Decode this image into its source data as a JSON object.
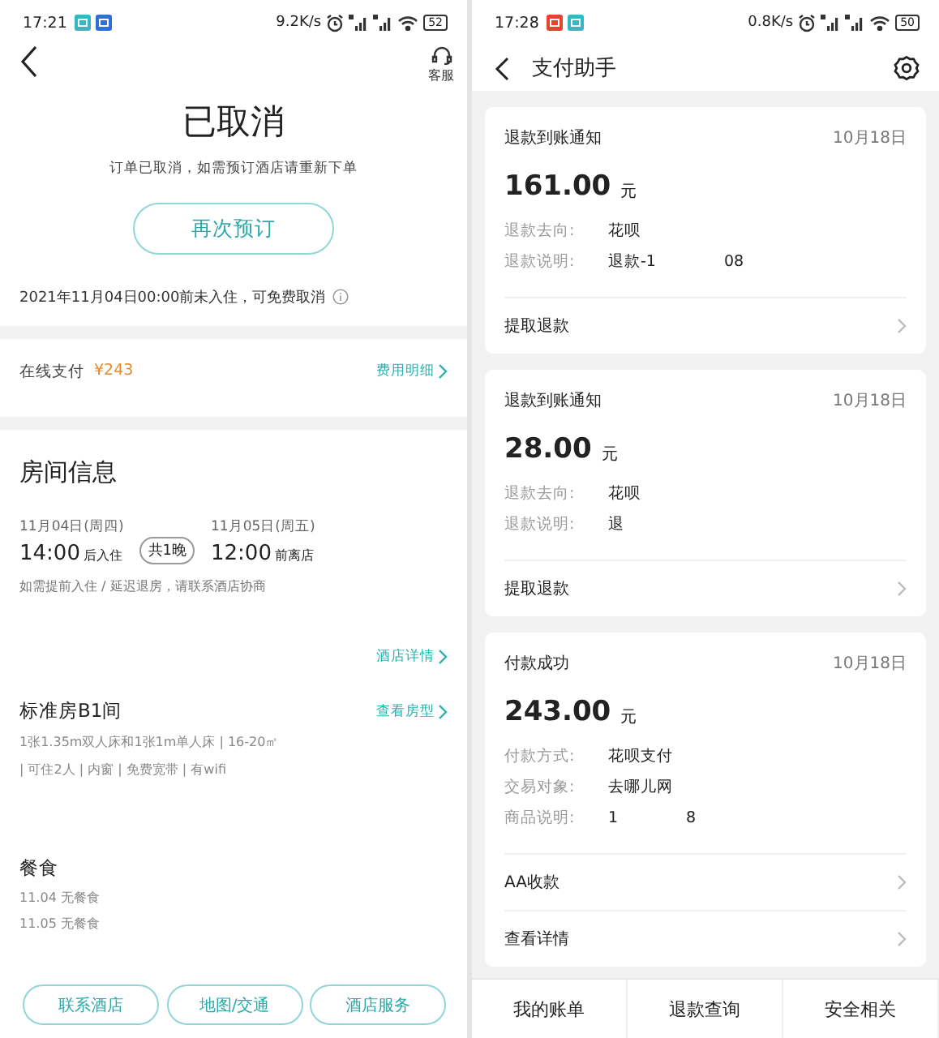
{
  "left_screen": {
    "status_bar": {
      "time": "17:21",
      "notification_icons": [
        {
          "color": "#35b8c4"
        },
        {
          "color": "#2f6fd6"
        }
      ],
      "net_speed": "9.2K/s",
      "battery": "52"
    },
    "header": {
      "service_label": "客服"
    },
    "status_title": "已取消",
    "status_message": "订单已取消，如需预订酒店请重新下单",
    "rebook_button": "再次预订",
    "cancel_policy": "2021年11月04日00:00前未入住，可免费取消",
    "payment": {
      "label": "在线支付",
      "amount": "¥243",
      "link": "费用明细"
    },
    "room_info": {
      "title": "房间信息",
      "checkin": {
        "date": "11月04日(周四)",
        "time": "14:00",
        "suffix": "后入住"
      },
      "nights": "共1晚",
      "checkout": {
        "date": "11月05日(周五)",
        "time": "12:00",
        "suffix": "前离店"
      },
      "note": "如需提前入住 / 延迟退房，请联系酒店协商",
      "hotel_link": "酒店详情",
      "room_name": "标准房B1间",
      "room_link": "查看房型",
      "specs": [
        "1张1.35m双人床和1张1m单人床 | 16-20㎡",
        "| 可住2人 | 内窗 | 免费宽带 | 有wifi"
      ],
      "meals": {
        "title": "餐食",
        "items": [
          "11.04 无餐食",
          "11.05 无餐食"
        ]
      }
    },
    "actions": [
      "联系酒店",
      "地图/交通",
      "酒店服务"
    ]
  },
  "right_screen": {
    "status_bar": {
      "time": "17:28",
      "notification_icons": [
        {
          "color": "#e8432e"
        },
        {
          "color": "#35b8c4"
        }
      ],
      "net_speed": "0.8K/s",
      "battery": "50"
    },
    "title": "支付助手",
    "cards": [
      {
        "title": "退款到账通知",
        "date": "10月18日",
        "amount": "161.00",
        "unit": "元",
        "fields": [
          {
            "label": "退款去向:",
            "value": "花呗"
          },
          {
            "label": "退款说明:",
            "value": "退款-1",
            "value_tail": "08"
          }
        ],
        "actions": [
          "提取退款"
        ]
      },
      {
        "title": "退款到账通知",
        "date": "10月18日",
        "amount": "28.00",
        "unit": "元",
        "fields": [
          {
            "label": "退款去向:",
            "value": "花呗"
          },
          {
            "label": "退款说明:",
            "value": "退"
          }
        ],
        "actions": [
          "提取退款"
        ]
      },
      {
        "title": "付款成功",
        "date": "10月18日",
        "amount": "243.00",
        "unit": "元",
        "fields": [
          {
            "label": "付款方式:",
            "value": "花呗支付"
          },
          {
            "label": "交易对象:",
            "value": "去哪儿网"
          },
          {
            "label": "商品说明:",
            "value": "1",
            "value_tail": "8"
          }
        ],
        "actions": [
          "AA收款",
          "查看详情"
        ]
      }
    ],
    "bottom_nav": [
      "我的账单",
      "退款查询",
      "安全相关"
    ]
  }
}
